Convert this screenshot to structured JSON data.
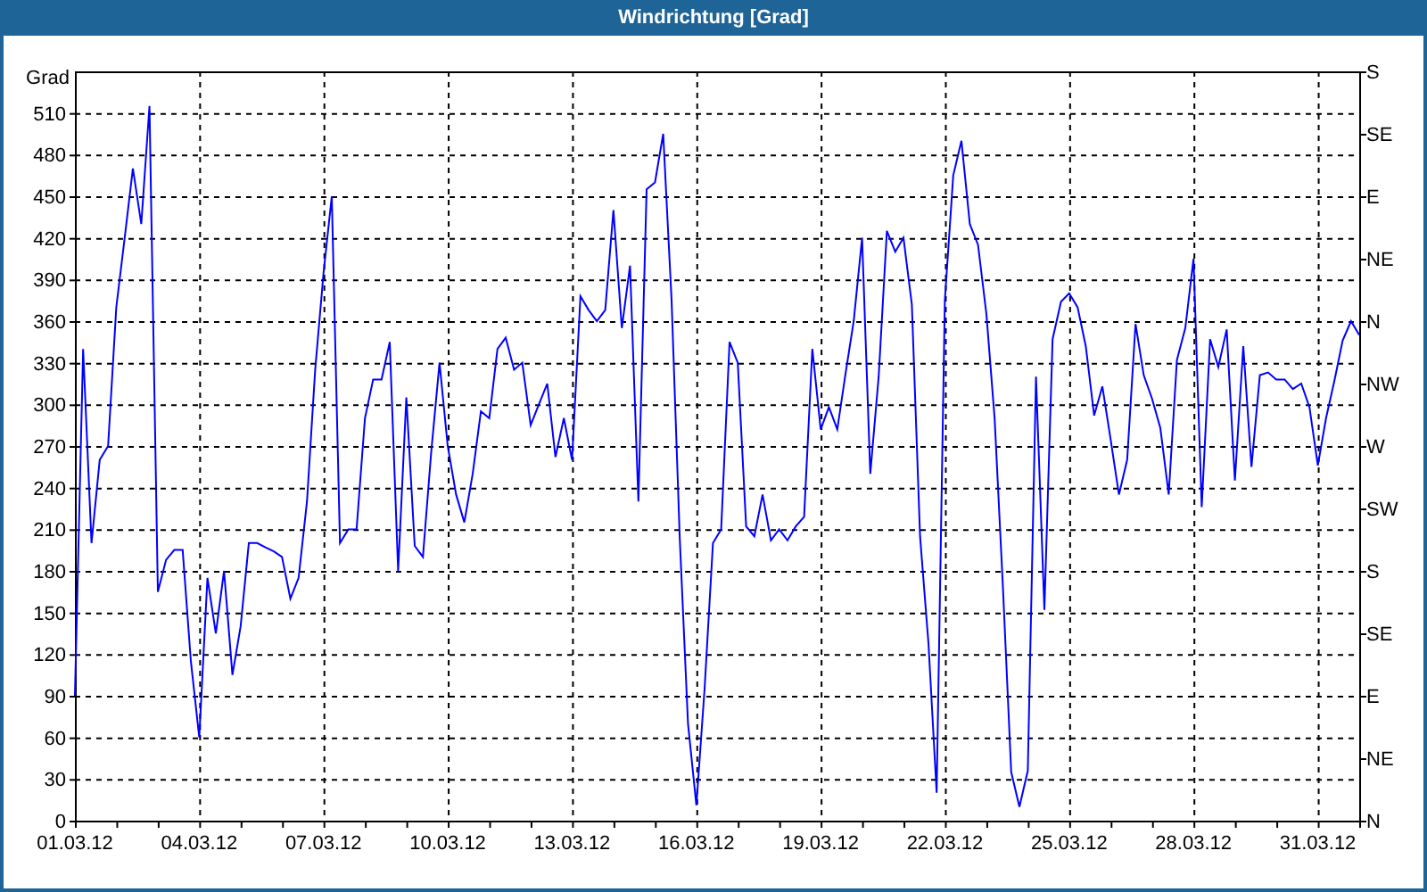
{
  "window": {
    "title": "Windrichtung [Grad]"
  },
  "chart": {
    "right_axis_labels": [
      "S",
      "SE",
      "E",
      "NE",
      "N",
      "NW",
      "W",
      "SW",
      "S",
      "SE",
      "E",
      "NE",
      "N"
    ],
    "chart_data": {
      "type": "line",
      "grid": true,
      "ylabel": "Grad",
      "ylim": [
        0,
        540
      ],
      "yticks": [
        0,
        30,
        60,
        90,
        120,
        150,
        180,
        210,
        240,
        270,
        300,
        330,
        360,
        390,
        420,
        450,
        480,
        510
      ],
      "categories": [
        "01.03.12",
        null,
        null,
        null,
        null,
        null,
        null,
        null,
        null,
        null,
        null,
        null,
        null,
        null,
        null,
        "04.03.12",
        null,
        null,
        null,
        null,
        null,
        null,
        null,
        null,
        null,
        null,
        null,
        null,
        null,
        null,
        "07.03.12",
        null,
        null,
        null,
        null,
        null,
        null,
        null,
        null,
        null,
        null,
        null,
        null,
        null,
        null,
        "10.03.12",
        null,
        null,
        null,
        null,
        null,
        null,
        null,
        null,
        null,
        null,
        null,
        null,
        null,
        null,
        "13.03.12",
        null,
        null,
        null,
        null,
        null,
        null,
        null,
        null,
        null,
        null,
        null,
        null,
        null,
        null,
        "16.03.12",
        null,
        null,
        null,
        null,
        null,
        null,
        null,
        null,
        null,
        null,
        null,
        null,
        null,
        null,
        "19.03.12",
        null,
        null,
        null,
        null,
        null,
        null,
        null,
        null,
        null,
        null,
        null,
        null,
        null,
        null,
        "22.03.12",
        null,
        null,
        null,
        null,
        null,
        null,
        null,
        null,
        null,
        null,
        null,
        null,
        null,
        null,
        "25.03.12",
        null,
        null,
        null,
        null,
        null,
        null,
        null,
        null,
        null,
        null,
        null,
        null,
        null,
        null,
        "28.03.12",
        null,
        null,
        null,
        null,
        null,
        null,
        null,
        null,
        null,
        null,
        null,
        null,
        null,
        null,
        "31.03.12",
        null,
        null,
        null,
        null,
        null
      ],
      "series": [
        {
          "color": "#0000ff",
          "values": [
            90,
            340,
            200,
            260,
            270,
            370,
            420,
            470,
            430,
            515,
            165,
            188,
            195,
            195,
            115,
            60,
            175,
            135,
            180,
            105,
            140,
            200,
            200,
            197,
            194,
            190,
            160,
            175,
            230,
            325,
            395,
            450,
            200,
            210,
            210,
            290,
            318,
            318,
            345,
            180,
            305,
            198,
            190,
            265,
            330,
            270,
            235,
            215,
            250,
            295,
            290,
            340,
            348,
            325,
            330,
            285,
            300,
            315,
            262,
            290,
            260,
            378,
            368,
            360,
            368,
            440,
            355,
            400,
            230,
            455,
            460,
            495,
            375,
            203,
            70,
            11,
            95,
            200,
            210,
            345,
            330,
            212,
            205,
            235,
            202,
            210,
            202,
            212,
            219,
            340,
            282,
            298,
            282,
            322,
            360,
            420,
            250,
            320,
            425,
            410,
            420,
            372,
            205,
            128,
            20,
            375,
            465,
            490,
            430,
            415,
            365,
            290,
            167,
            35,
            10,
            36,
            320,
            152,
            347,
            374,
            380,
            370,
            342,
            292,
            313,
            275,
            235,
            260,
            358,
            321,
            304,
            283,
            235,
            332,
            355,
            405,
            226,
            347,
            327,
            354,
            245,
            342,
            255,
            321,
            323,
            318,
            318,
            311,
            315,
            298,
            256,
            290,
            317,
            346,
            360,
            350
          ]
        }
      ]
    }
  }
}
